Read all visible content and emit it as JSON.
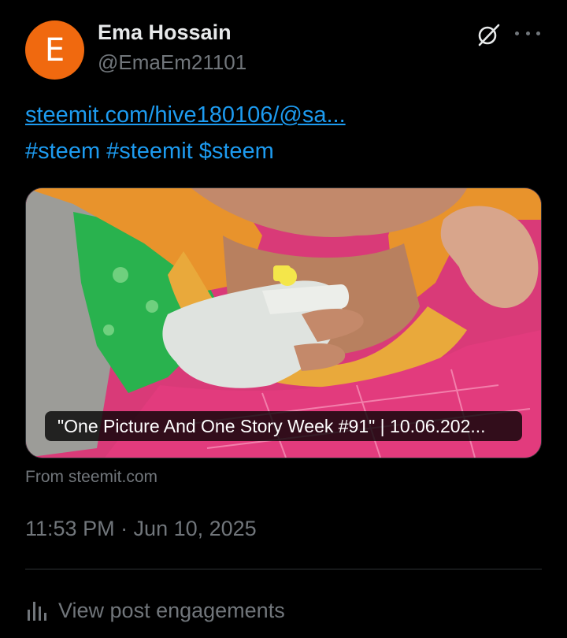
{
  "post": {
    "author": {
      "avatar_letter": "E",
      "avatar_color": "#f0690f",
      "display_name": "Ema Hossain",
      "handle": "@EmaEm21101"
    },
    "header_icons": [
      "grok-icon",
      "more-icon"
    ],
    "link_text": "steemit.com/hive180106/@sa...",
    "hashtags": [
      "#steem",
      "#steemit",
      "$steem"
    ],
    "card": {
      "title": "\"One Picture And One Story Week #91\" | 10.06.202...",
      "source": "From steemit.com"
    },
    "timestamp": "11:53 PM · Jun 10, 2025",
    "engagements_label": "View post engagements"
  },
  "colors": {
    "background": "#000000",
    "primary_text": "#e7e9ea",
    "secondary_text": "#71767b",
    "link": "#1d9bf0",
    "divider": "#2f3336"
  }
}
